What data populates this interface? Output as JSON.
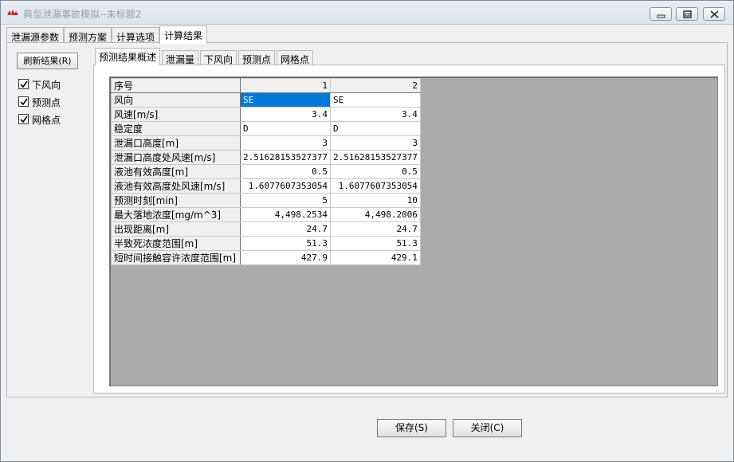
{
  "window": {
    "title": "典型泄漏事故模拟--未标题2",
    "title_color": "#9aa0a6",
    "icon": "fire-app-icon",
    "controls": [
      "minimize-icon",
      "maximize-icon",
      "close-icon"
    ]
  },
  "main_tabs": [
    {
      "label": "泄漏源参数",
      "active": false
    },
    {
      "label": "预测方案",
      "active": false
    },
    {
      "label": "计算选项",
      "active": false
    },
    {
      "label": "计算结果",
      "active": true
    }
  ],
  "left_panel": {
    "refresh_button": "刷新结果(R)",
    "checkboxes": [
      {
        "label": "下风向",
        "checked": true
      },
      {
        "label": "预测点",
        "checked": true
      },
      {
        "label": "网格点",
        "checked": true
      }
    ]
  },
  "sub_tabs": [
    {
      "label": "预测结果概述",
      "active": true
    },
    {
      "label": "泄漏量",
      "active": false
    },
    {
      "label": "下风向",
      "active": false
    },
    {
      "label": "预测点",
      "active": false
    },
    {
      "label": "网格点",
      "active": false
    }
  ],
  "grid": {
    "header_label": "序号",
    "columns": [
      "1",
      "2"
    ],
    "selection_color": "#0078d7",
    "rows": [
      {
        "label": "风向",
        "values": [
          "SE",
          "SE"
        ],
        "align": "left"
      },
      {
        "label": "风速[m/s]",
        "values": [
          "3.4",
          "3.4"
        ],
        "align": "right"
      },
      {
        "label": "稳定度",
        "values": [
          "D",
          "D"
        ],
        "align": "left"
      },
      {
        "label": "泄漏口高度[m]",
        "values": [
          "3",
          "3"
        ],
        "align": "right"
      },
      {
        "label": "泄漏口高度处风速[m/s]",
        "values": [
          "2.51628153527377",
          "2.51628153527377"
        ],
        "align": "right"
      },
      {
        "label": "液池有效高度[m]",
        "values": [
          "0.5",
          "0.5"
        ],
        "align": "right"
      },
      {
        "label": "液池有效高度处风速[m/s]",
        "values": [
          "1.6077607353054",
          "1.6077607353054"
        ],
        "align": "right"
      },
      {
        "label": "预测时刻[min]",
        "values": [
          "5",
          "10"
        ],
        "align": "right"
      },
      {
        "label": "最大落地浓度[mg/m^3]",
        "values": [
          "4,498.2534",
          "4,498.2006"
        ],
        "align": "right"
      },
      {
        "label": "出现距离[m]",
        "values": [
          "24.7",
          "24.7"
        ],
        "align": "right"
      },
      {
        "label": "半致死浓度范围[m]",
        "values": [
          "51.3",
          "51.3"
        ],
        "align": "right"
      },
      {
        "label": "短时间接触容许浓度范围[m]",
        "values": [
          "427.9",
          "429.1"
        ],
        "align": "right"
      }
    ]
  },
  "footer": {
    "save_button": "保存(S)",
    "close_button": "关闭(C)"
  }
}
